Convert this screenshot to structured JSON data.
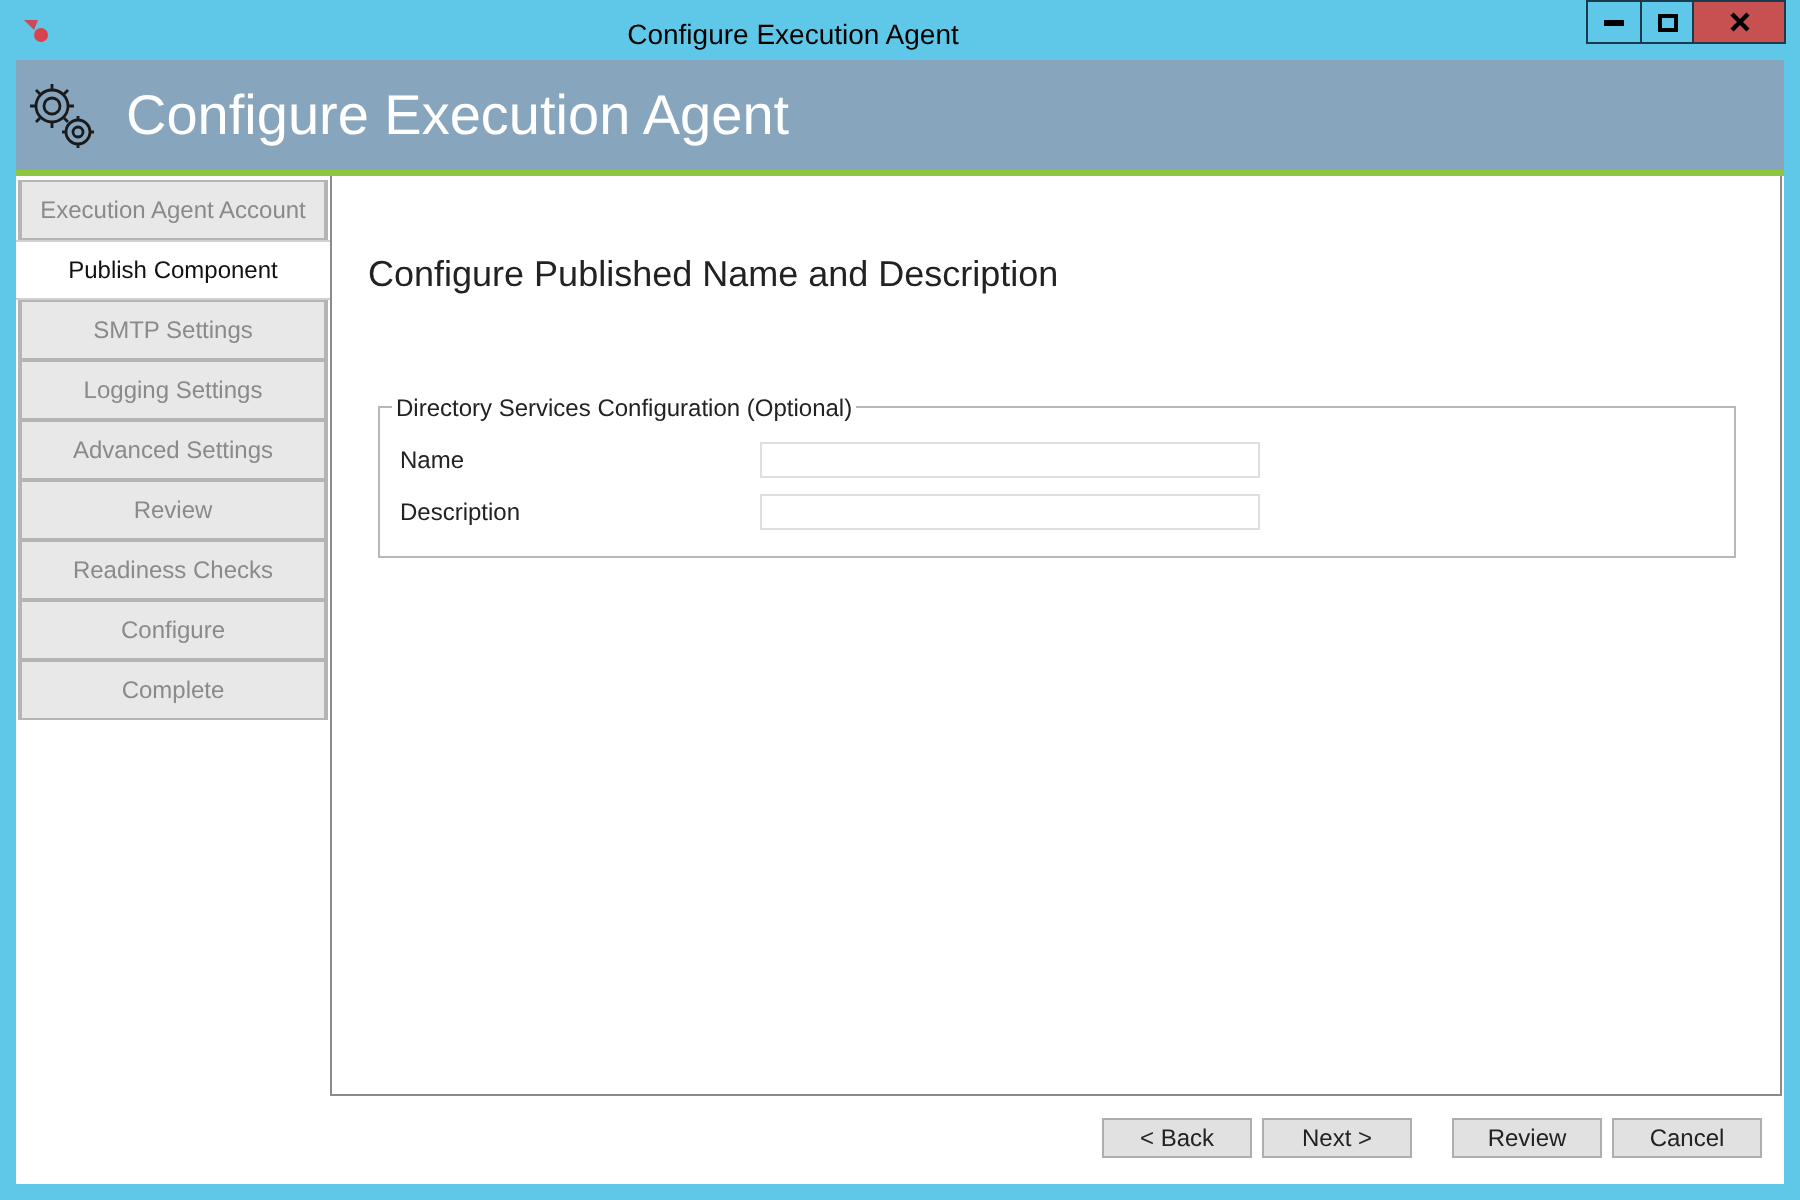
{
  "window": {
    "title": "Configure Execution Agent"
  },
  "header": {
    "title": "Configure Execution Agent"
  },
  "steps": [
    {
      "label": "Execution Agent Account",
      "selected": false
    },
    {
      "label": "Publish Component",
      "selected": true
    },
    {
      "label": "SMTP Settings",
      "selected": false
    },
    {
      "label": "Logging Settings",
      "selected": false
    },
    {
      "label": "Advanced Settings",
      "selected": false
    },
    {
      "label": "Review",
      "selected": false
    },
    {
      "label": "Readiness Checks",
      "selected": false
    },
    {
      "label": "Configure",
      "selected": false
    },
    {
      "label": "Complete",
      "selected": false
    }
  ],
  "page": {
    "heading": "Configure Published Name and Description",
    "group": {
      "legend": "Directory Services Configuration (Optional)",
      "fields": [
        {
          "label": "Name"
        },
        {
          "label": "Description"
        }
      ]
    }
  },
  "buttons": [
    "< Back",
    "Next >",
    "Review",
    "Cancel"
  ]
}
